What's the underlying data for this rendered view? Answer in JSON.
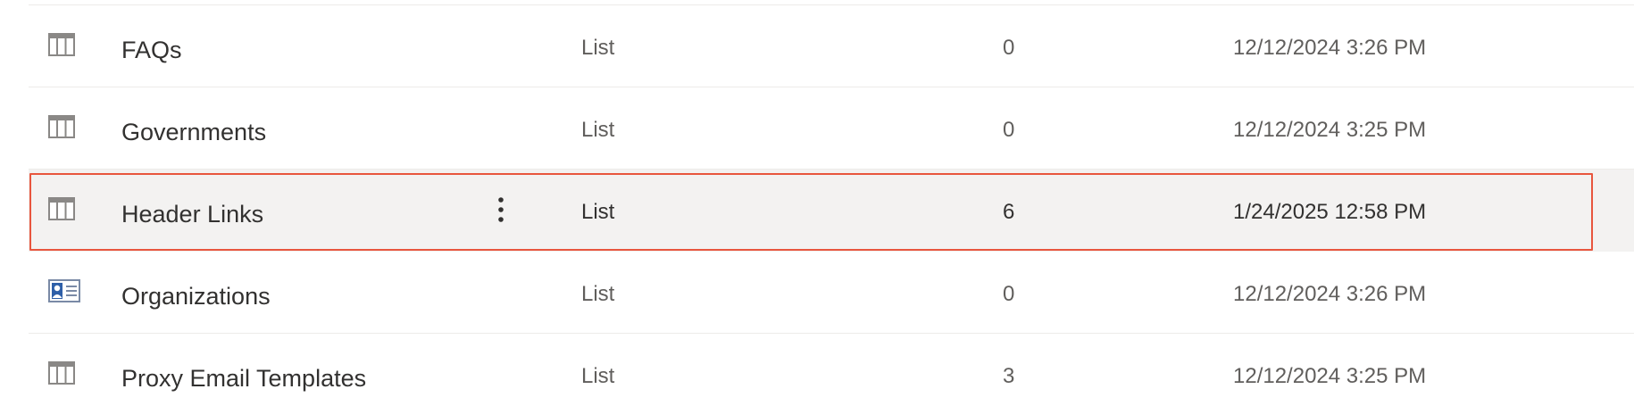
{
  "rows": [
    {
      "name": "FAQs",
      "type": "List",
      "items": "0",
      "modified": "12/12/2024 3:26 PM",
      "icon": "list-grid-icon",
      "selected": false
    },
    {
      "name": "Governments",
      "type": "List",
      "items": "0",
      "modified": "12/12/2024 3:25 PM",
      "icon": "list-grid-icon",
      "selected": false
    },
    {
      "name": "Header Links",
      "type": "List",
      "items": "6",
      "modified": "1/24/2025 12:58 PM",
      "icon": "list-grid-icon",
      "selected": true
    },
    {
      "name": "Organizations",
      "type": "List",
      "items": "0",
      "modified": "12/12/2024 3:26 PM",
      "icon": "contacts-list-icon",
      "selected": false
    },
    {
      "name": "Proxy Email Templates",
      "type": "List",
      "items": "3",
      "modified": "12/12/2024 3:25 PM",
      "icon": "list-grid-icon",
      "selected": false
    }
  ],
  "colors": {
    "selection_outline": "#e8563e",
    "selected_background": "#f3f2f1",
    "divider": "#edebe9"
  }
}
